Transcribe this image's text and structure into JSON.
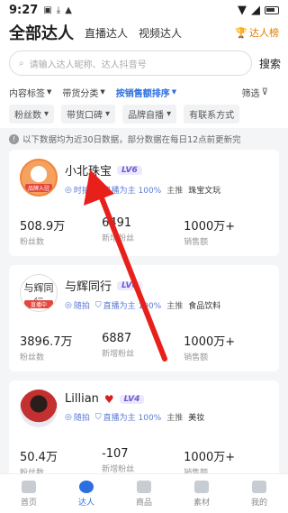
{
  "status": {
    "time": "9:27"
  },
  "header": {
    "title": "全部达人",
    "tabs": [
      "直播达人",
      "视频达人"
    ],
    "rank_label": "达人榜"
  },
  "search": {
    "placeholder": "请输入达人昵称、达人抖音号",
    "button": "搜索"
  },
  "filters": {
    "items": [
      "内容标签",
      "带货分类",
      "按销售额排序"
    ],
    "screen": "筛选"
  },
  "chips": [
    "粉丝数",
    "带货口碑",
    "品牌自播",
    "有联系方式"
  ],
  "notice": "以下数据均为近30日数据，部分数据在每日12点前更新完",
  "cards": [
    {
      "avatar_tag": "品牌入驻",
      "name": "小北珠宝",
      "level": "LV6",
      "tag1": "时拍",
      "tag2": "直播为主 100%",
      "main_label": "主推",
      "main_value": "珠宝文玩",
      "stats": [
        {
          "value": "508.9万",
          "label": "粉丝数"
        },
        {
          "value": "6491",
          "label": "新增粉丝"
        },
        {
          "value": "1000万+",
          "label": "销售额"
        }
      ]
    },
    {
      "avatar_text": "与辉同行",
      "avatar_tag": "直播中",
      "name": "与辉同行",
      "level": "LV6",
      "tag1": "随拍",
      "tag2": "直播为主 100%",
      "main_label": "主推",
      "main_value": "食品饮料",
      "stats": [
        {
          "value": "3896.7万",
          "label": "粉丝数"
        },
        {
          "value": "6887",
          "label": "新增粉丝"
        },
        {
          "value": "1000万+",
          "label": "销售额"
        }
      ]
    },
    {
      "name": "Lillian",
      "level": "LV4",
      "tag1": "随拍",
      "tag2": "直播为主 100%",
      "main_label": "主推",
      "main_value": "美妆",
      "stats": [
        {
          "value": "50.4万",
          "label": "粉丝数"
        },
        {
          "value": "-107",
          "label": "新增粉丝"
        },
        {
          "value": "1000万+",
          "label": "销售额"
        }
      ]
    }
  ],
  "tabbar": [
    "首页",
    "达人",
    "商品",
    "素材",
    "我的"
  ],
  "colors": {
    "accent": "#2b6fe0",
    "arrow": "#e8201c",
    "level": "#6a5acd"
  }
}
